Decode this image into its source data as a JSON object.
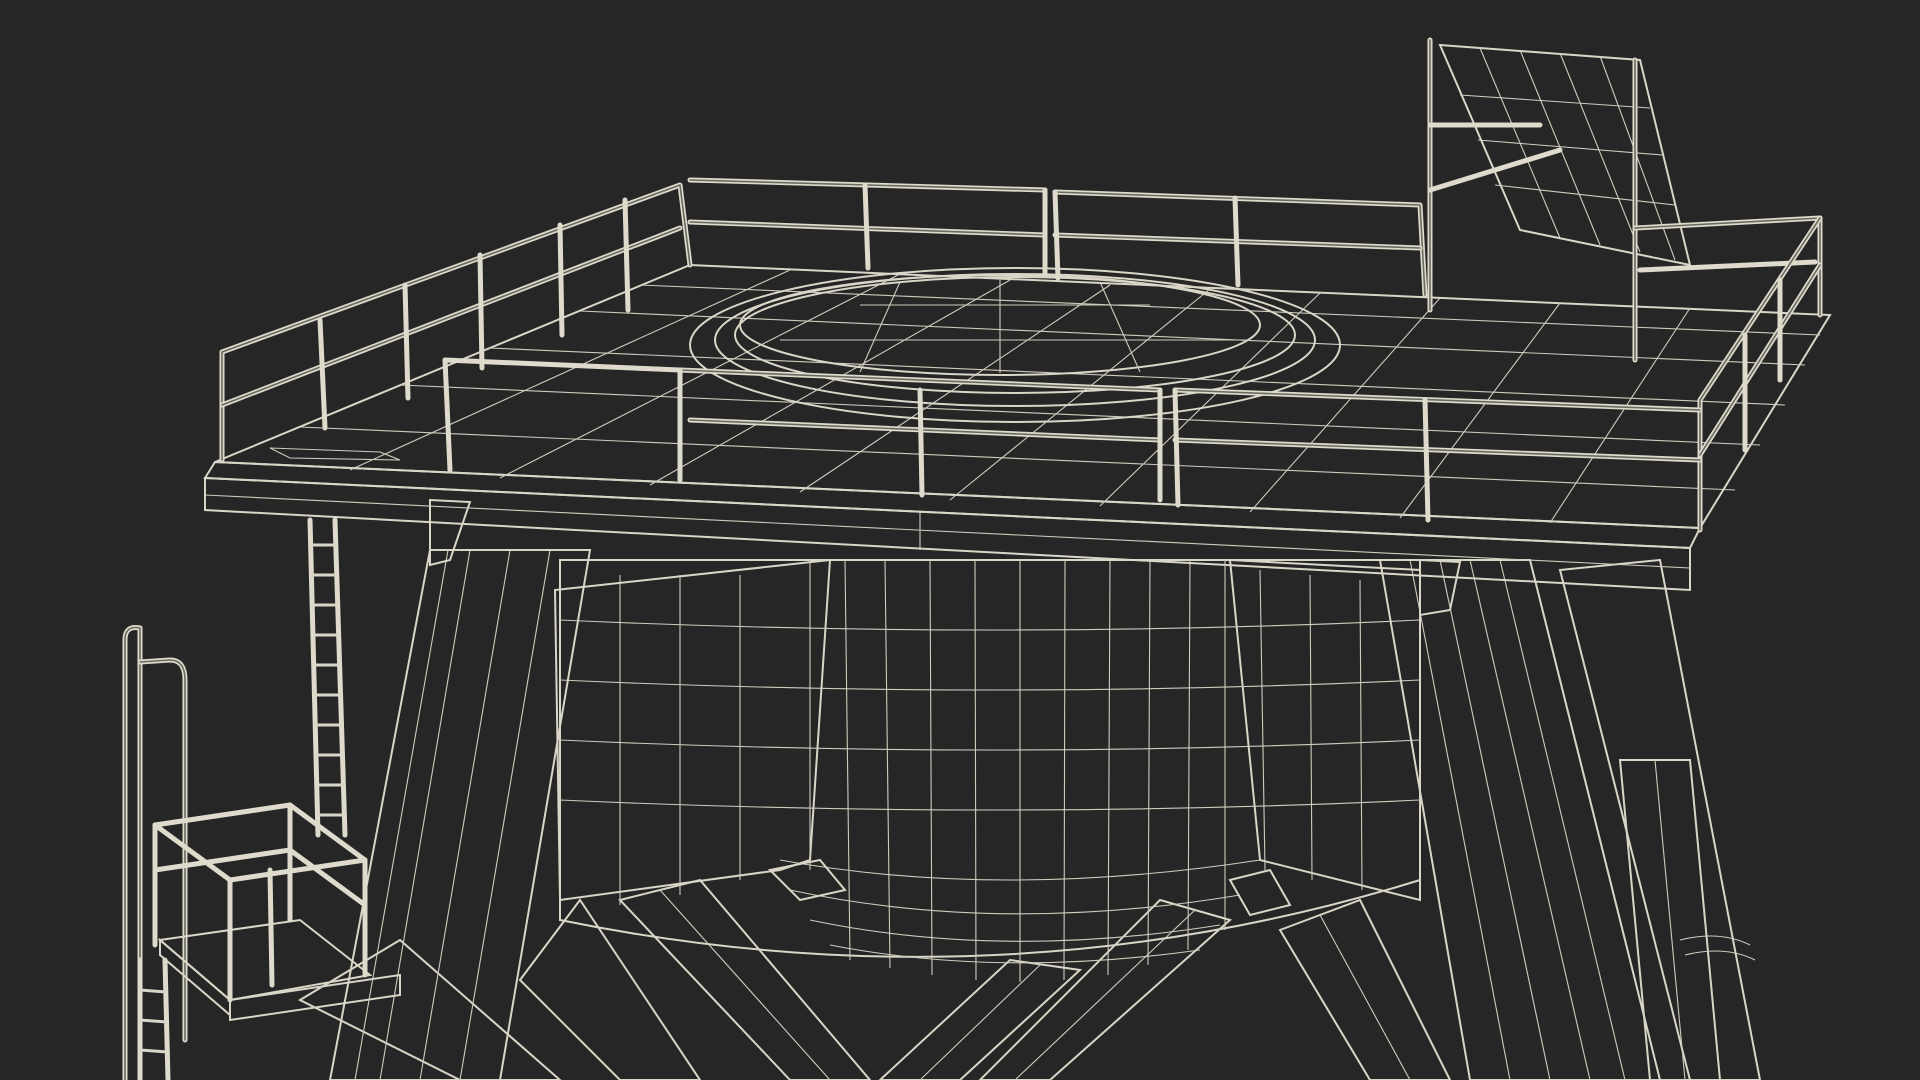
{
  "scene": {
    "subject": "offshore-platform-wireframe",
    "background_color": "#262626",
    "surface_color": "#6f6f66",
    "surface_dark": "#55554e",
    "wire_color": "#d9d6c8",
    "components": [
      "deck",
      "railing",
      "helipad-ring",
      "solar-panel",
      "tower-legs",
      "central-caisson",
      "cross-braces",
      "ladder",
      "access-stair"
    ]
  }
}
